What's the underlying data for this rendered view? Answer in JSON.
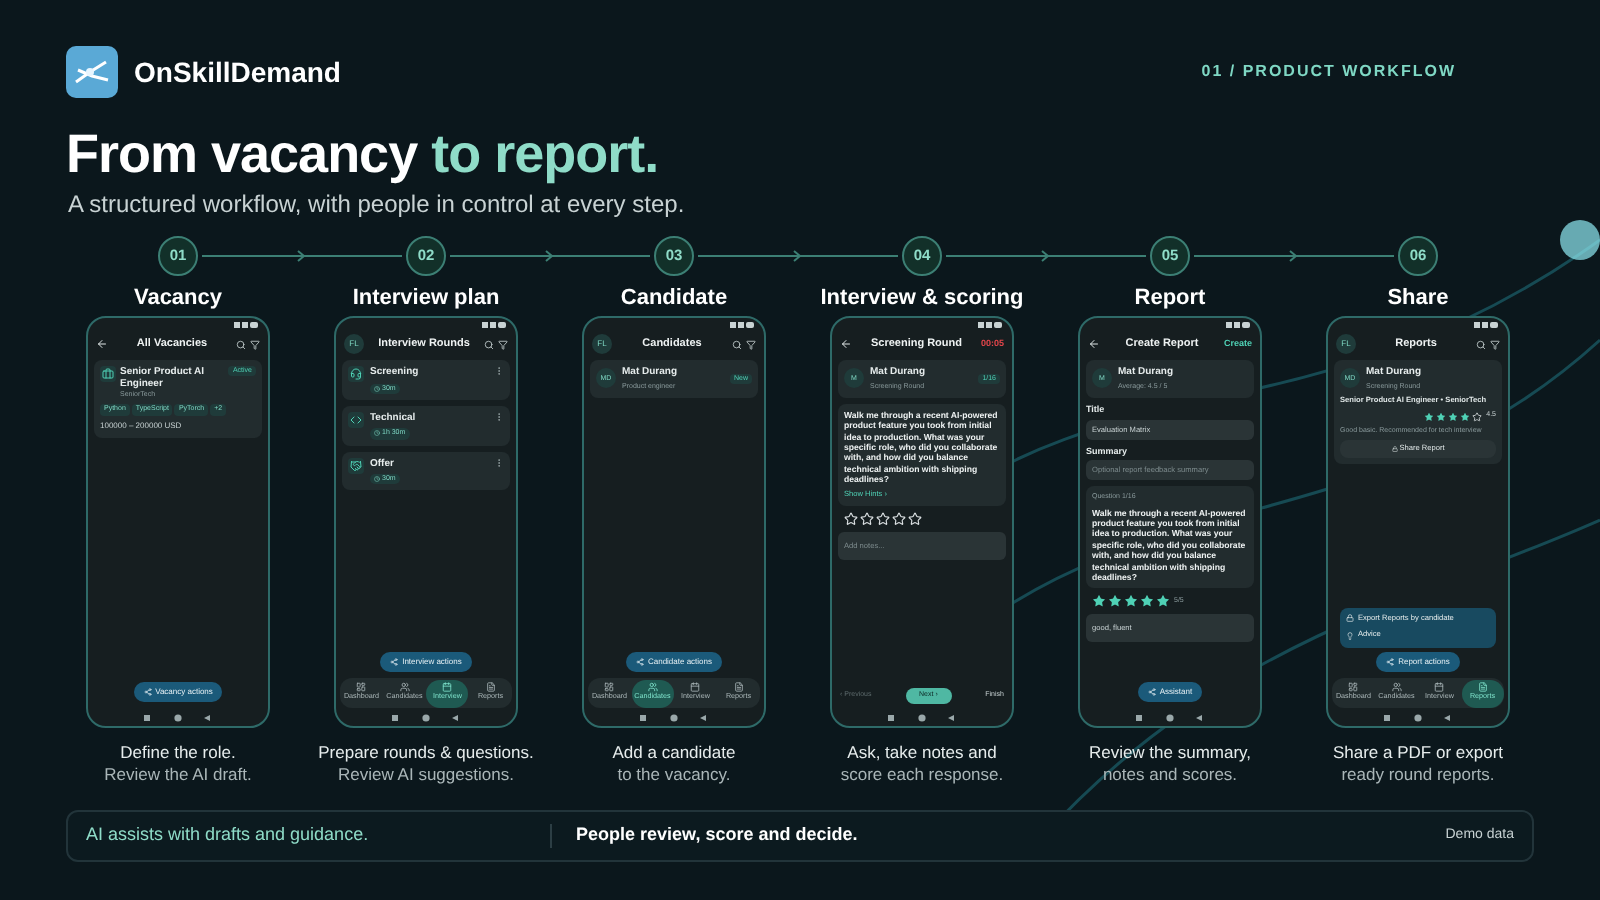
{
  "brand": {
    "name": "OnSkillDemand"
  },
  "section_label": "01 / PRODUCT WORKFLOW",
  "headline": {
    "lead": "From vacancy",
    "accent": "to report."
  },
  "subtitle": "A structured workflow, with people in control at every step.",
  "steps": [
    {
      "number": "01",
      "title": "Vacancy",
      "caption": [
        "Define the role.",
        "Review the AI draft."
      ],
      "phone": {
        "back": true,
        "title": "All Vacancies",
        "search": true,
        "blocks": [
          {
            "kind": "vacancy",
            "title": "Senior Product AI Engineer",
            "company": "SeniorTech",
            "status": "Active",
            "tags": [
              "Python",
              "TypeScript",
              "PyTorch",
              "+2"
            ],
            "salary": "100000 – 200000 USD"
          }
        ],
        "fab": "Vacancy actions"
      }
    },
    {
      "number": "02",
      "title": "Interview plan",
      "caption": [
        "Prepare rounds & questions.",
        "Review AI suggestions."
      ],
      "phone": {
        "avatar": "FL",
        "title": "Interview Rounds",
        "search": true,
        "blocks": [
          {
            "kind": "round",
            "title": "Screening",
            "duration": "30m"
          },
          {
            "kind": "round",
            "title": "Technical",
            "duration": "1h 30m"
          },
          {
            "kind": "round",
            "title": "Offer",
            "duration": "30m"
          }
        ],
        "fab": "Interview actions",
        "nav": [
          {
            "label": "Dashboard",
            "selected": false
          },
          {
            "label": "Candidates",
            "selected": false
          },
          {
            "label": "Interview",
            "selected": true
          },
          {
            "label": "Reports",
            "selected": false
          }
        ]
      }
    },
    {
      "number": "03",
      "title": "Candidate",
      "caption": [
        "Add a candidate",
        "to the vacancy."
      ],
      "phone": {
        "avatar": "FL",
        "title": "Candidates",
        "search": true,
        "blocks": [
          {
            "kind": "person",
            "initials": "MD",
            "name": "Mat Durang",
            "role": "Product engineer",
            "status": "New"
          }
        ],
        "fab": "Candidate actions",
        "nav": [
          {
            "label": "Dashboard",
            "selected": false
          },
          {
            "label": "Candidates",
            "selected": true
          },
          {
            "label": "Interview",
            "selected": false
          },
          {
            "label": "Reports",
            "selected": false
          }
        ]
      }
    },
    {
      "number": "04",
      "title": "Interview & scoring",
      "caption": [
        "Ask, take notes and",
        "score each response."
      ],
      "phone": {
        "back": true,
        "title": "Screening Round",
        "timer": "00:05",
        "blocks": [
          {
            "kind": "person",
            "initials": "M",
            "name": "Mat Durang",
            "role": "Screening Round",
            "counter": "1/16"
          },
          {
            "kind": "question",
            "text": "Walk me through a recent AI-powered product feature you took from initial idea to production. What was your specific role, who did you collaborate with, and how did you balance technical ambition with shipping deadlines?",
            "link": "Show Hints ›"
          },
          {
            "kind": "stars",
            "stars": 0
          },
          {
            "kind": "notes",
            "placeholder": "Add notes..."
          }
        ],
        "footer_buttons": [
          "‹ Previous",
          "Next ›",
          "Finish"
        ]
      }
    },
    {
      "number": "05",
      "title": "Report",
      "caption": [
        "Review the summary,",
        "notes and scores."
      ],
      "phone": {
        "back": true,
        "title": "Create Report",
        "action": "Create",
        "blocks": [
          {
            "kind": "person",
            "initials": "M",
            "name": "Mat Durang",
            "role": "Average: 4.5 / 5"
          },
          {
            "kind": "field",
            "label": "Title",
            "value": "Evaluation Matrix"
          },
          {
            "kind": "field",
            "label": "Summary",
            "placeholder": "Optional report feedback summary"
          },
          {
            "kind": "question",
            "label": "Question 1/16",
            "text": "Walk me through a recent AI-powered product feature you took from initial idea to production. What was your specific role, who did you collaborate with, and how did you balance technical ambition with shipping deadlines?"
          },
          {
            "kind": "stars",
            "stars": 5,
            "reading": "5/5"
          },
          {
            "kind": "notes",
            "value": "good, fluent"
          }
        ],
        "fab": "Assistant"
      }
    },
    {
      "number": "06",
      "title": "Share",
      "caption": [
        "Share a PDF or export",
        "ready round reports."
      ],
      "phone": {
        "avatar": "FL",
        "title": "Reports",
        "search": true,
        "blocks": [
          {
            "kind": "report",
            "initials": "MD",
            "name": "Mat Durang",
            "round": "Screening Round",
            "position": "Senior Product AI Engineer • SeniorTech",
            "stars": 4,
            "score": "4.5",
            "note": "Good basic. Recommended for tech interview",
            "button": "Share Report"
          }
        ],
        "menu": [
          "Export Reports by candidate",
          "Advice"
        ],
        "fab": "Report actions",
        "nav": [
          {
            "label": "Dashboard",
            "selected": false
          },
          {
            "label": "Candidates",
            "selected": false
          },
          {
            "label": "Interview",
            "selected": false
          },
          {
            "label": "Reports",
            "selected": true
          }
        ]
      }
    }
  ],
  "footer": {
    "ai_note": "AI assists with drafts and guidance.",
    "people_note": "People review, score and decide.",
    "tag": "Demo data"
  }
}
